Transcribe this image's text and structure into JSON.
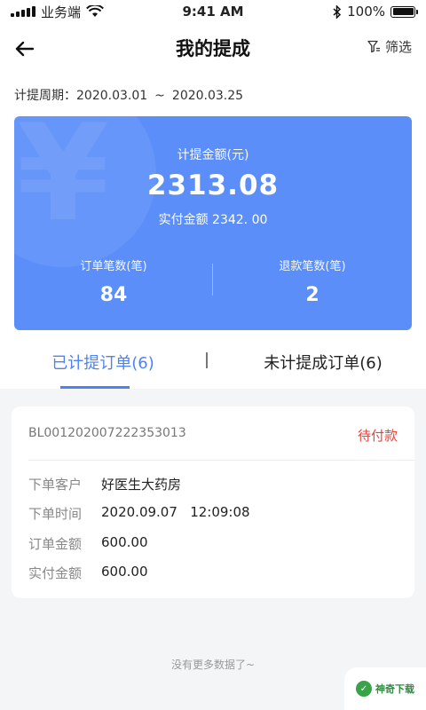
{
  "status_bar": {
    "carrier": "业务端",
    "time": "9:41 AM",
    "battery": "100%",
    "battery_level": 1.0
  },
  "nav": {
    "title": "我的提成",
    "filter_label": "筛选"
  },
  "period": {
    "label": "计提周期：",
    "start": "2020.03.01",
    "separator": "~",
    "end": "2020.03.25"
  },
  "summary": {
    "commission_label": "计提金额(元)",
    "commission_value": "2313.08",
    "actual_paid": "实付金额 2342. 00",
    "order_count_label": "订单笔数(笔)",
    "order_count": "84",
    "refund_count_label": "退款笔数(笔)",
    "refund_count": "2"
  },
  "tabs": [
    {
      "label": "已计提订单(6)",
      "active": true
    },
    {
      "label": "未计提成订单(6)",
      "active": false
    }
  ],
  "order": {
    "number": "BL001202007222353013",
    "status": "待付款",
    "rows": [
      {
        "key": "下单客户",
        "value": "好医生大药房"
      },
      {
        "key": "下单时间",
        "value": "2020.09.07   12:09:08"
      },
      {
        "key": "订单金额",
        "value": "600.00"
      },
      {
        "key": "实付金额",
        "value": "600.00"
      }
    ]
  },
  "footer": {
    "no_more": "没有更多数据了~"
  },
  "watermark": {
    "text": "神奇下载"
  },
  "colors": {
    "primary": "#5b8ef9",
    "tab_active": "#4d82f5",
    "status_red": "#e8423a"
  }
}
